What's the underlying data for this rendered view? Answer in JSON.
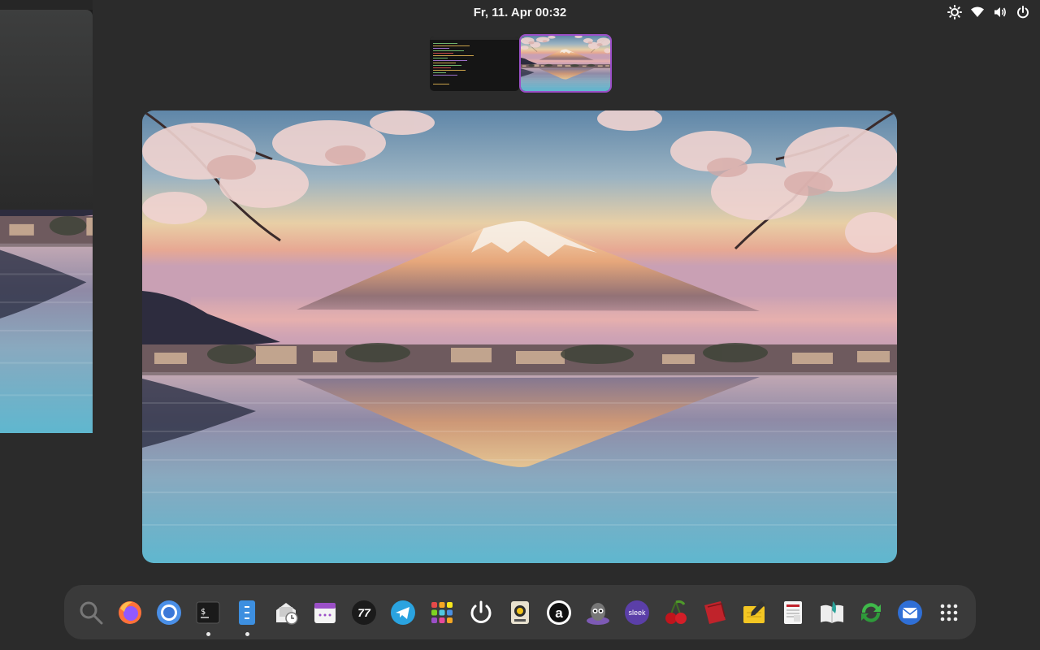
{
  "topbar": {
    "clock": "Fr, 11. Apr  00:32",
    "tray_icons": [
      "brightness-icon",
      "wifi-icon",
      "volume-icon",
      "power-icon"
    ]
  },
  "workspaces": [
    {
      "name": "workspace-1",
      "content": "terminal"
    },
    {
      "name": "workspace-2",
      "content": "wallpaper",
      "active": true
    }
  ],
  "dock": {
    "items": [
      {
        "name": "search-icon",
        "label": "Search"
      },
      {
        "name": "firefox-icon",
        "label": "Firefox"
      },
      {
        "name": "chromium-icon",
        "label": "Chromium"
      },
      {
        "name": "terminal-icon",
        "label": "Terminal",
        "running": true,
        "glyph": "$"
      },
      {
        "name": "file-manager-icon",
        "label": "Files",
        "running": true
      },
      {
        "name": "mail-clock-icon",
        "label": "Mail Scheduler"
      },
      {
        "name": "calendar-icon",
        "label": "Calendar"
      },
      {
        "name": "77-icon",
        "label": "77",
        "glyph": "77"
      },
      {
        "name": "telegram-icon",
        "label": "Telegram"
      },
      {
        "name": "app-grid-color-icon",
        "label": "Apps"
      },
      {
        "name": "power-app-icon",
        "label": "Power"
      },
      {
        "name": "audio-speaker-icon",
        "label": "Speaker"
      },
      {
        "name": "a-circle-icon",
        "label": "a",
        "glyph": "a"
      },
      {
        "name": "mascot-icon",
        "label": "Mascot"
      },
      {
        "name": "sleek-icon",
        "label": "sleek",
        "glyph": "sleek"
      },
      {
        "name": "cherry-icon",
        "label": "Cherry"
      },
      {
        "name": "red-book-icon",
        "label": "Book"
      },
      {
        "name": "notes-pencil-icon",
        "label": "Notes"
      },
      {
        "name": "document-viewer-icon",
        "label": "Documents"
      },
      {
        "name": "reader-icon",
        "label": "Reader"
      },
      {
        "name": "sync-icon",
        "label": "Sync"
      },
      {
        "name": "mail-icon",
        "label": "Mail"
      },
      {
        "name": "show-apps-icon",
        "label": "Show Apps"
      }
    ]
  },
  "colors": {
    "workspace_active": "#9b4fc7",
    "background": "#2b2b2b",
    "dock": "#3a3a3a"
  }
}
